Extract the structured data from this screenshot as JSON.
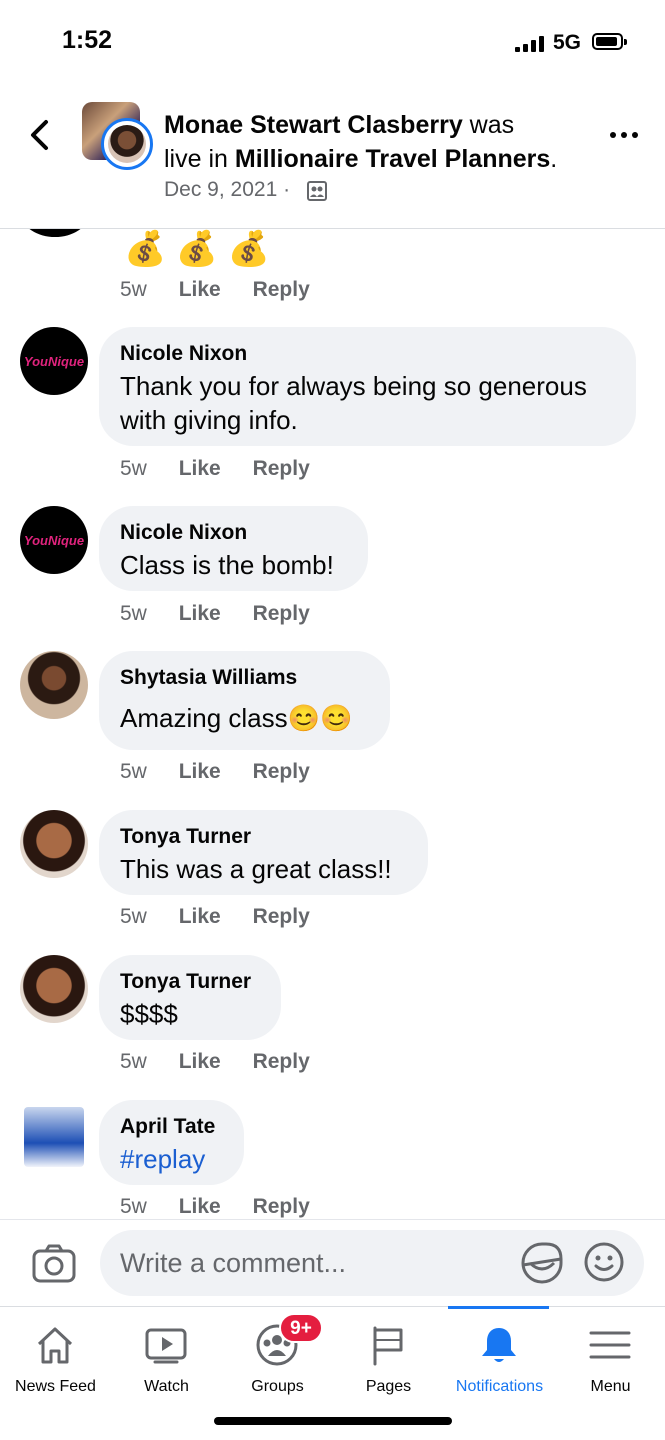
{
  "status_bar": {
    "time": "1:52",
    "network": "5G"
  },
  "header": {
    "author": "Monae Stewart Clasberry",
    "was_live_1": " was",
    "was_live_2": "live in ",
    "group": "Millionaire Travel Planners",
    "period": ".",
    "date": "Dec 9, 2021 ·"
  },
  "top_partial": {
    "emoji": "💰 💰 💰",
    "time": "5w",
    "like": "Like",
    "reply": "Reply"
  },
  "comments": [
    {
      "name": "Nicole Nixon",
      "text": "Thank you for always being so generous with giving info.",
      "time": "5w",
      "like": "Like",
      "reply": "Reply",
      "avatar_text": "YouNique"
    },
    {
      "name": "Nicole Nixon",
      "text": "Class is the bomb!",
      "time": "5w",
      "like": "Like",
      "reply": "Reply",
      "avatar_text": "YouNique"
    },
    {
      "name": "Shytasia Williams",
      "text": "Amazing class😊😊",
      "time": "5w",
      "like": "Like",
      "reply": "Reply"
    },
    {
      "name": "Tonya Turner",
      "text": "This was a great class!!",
      "time": "5w",
      "like": "Like",
      "reply": "Reply"
    },
    {
      "name": "Tonya Turner",
      "text": "$$$$",
      "time": "5w",
      "like": "Like",
      "reply": "Reply"
    },
    {
      "name": "April Tate",
      "text": "#replay",
      "time": "5w",
      "like": "Like",
      "reply": "Reply"
    }
  ],
  "composer": {
    "placeholder": "Write a comment..."
  },
  "tabs": [
    {
      "label": "News Feed",
      "icon": "home-icon"
    },
    {
      "label": "Watch",
      "icon": "video-icon"
    },
    {
      "label": "Groups",
      "icon": "groups-icon",
      "badge": "9+"
    },
    {
      "label": "Pages",
      "icon": "flag-icon"
    },
    {
      "label": "Notifications",
      "icon": "bell-icon",
      "active": true
    },
    {
      "label": "Menu",
      "icon": "hamburger-icon"
    }
  ],
  "colors": {
    "accent": "#1877f2",
    "bubble": "#f0f2f5",
    "badge": "#e41e3f",
    "secondary_text": "#65676b"
  }
}
